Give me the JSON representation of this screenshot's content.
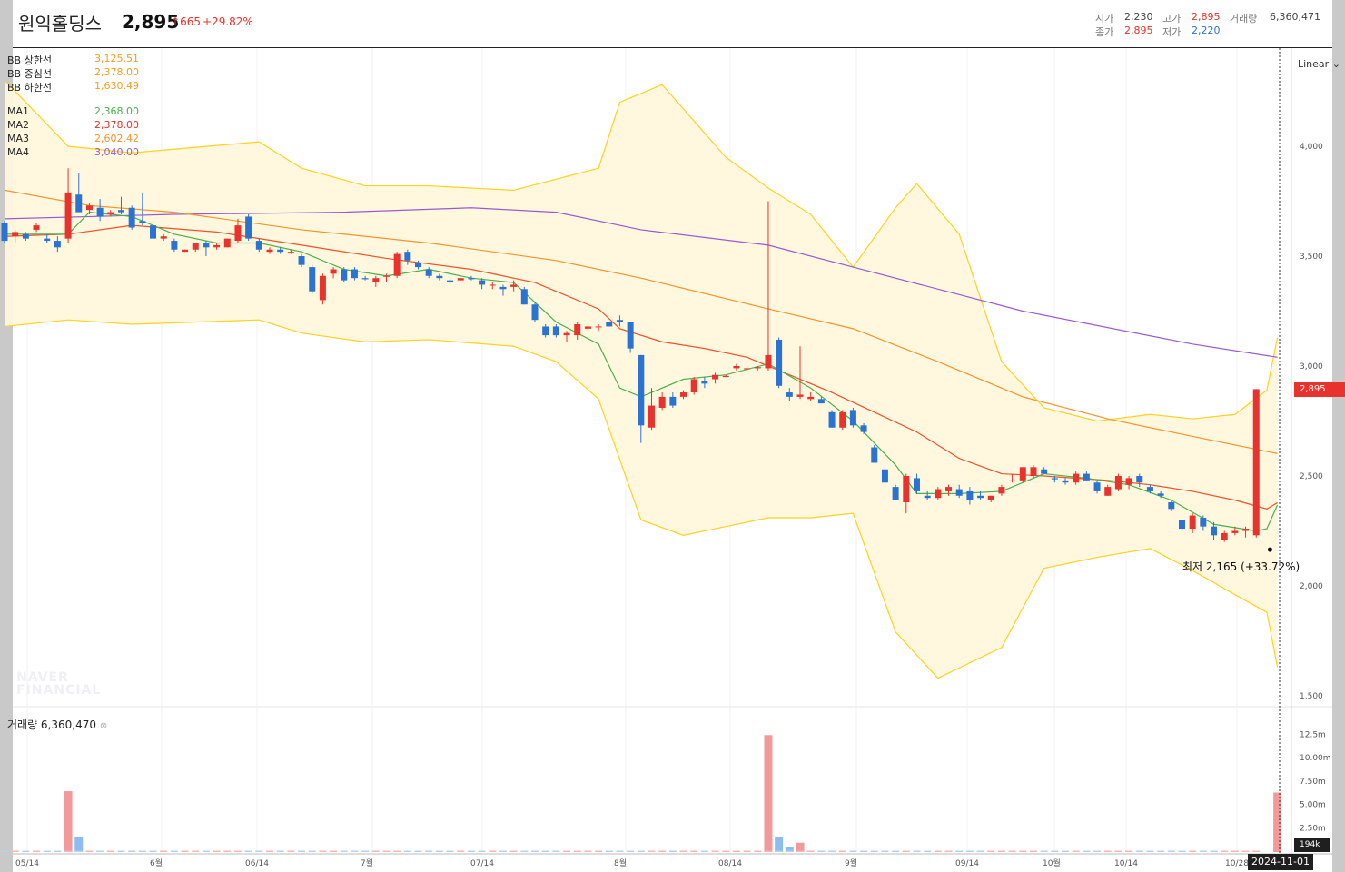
{
  "header": {
    "stock_name": "원익홀딩스",
    "price": "2,895",
    "change": "665",
    "change_pct": "+29.82%",
    "quote": {
      "open_label": "시가",
      "open": "2,230",
      "high_label": "고가",
      "high": "2,895",
      "volume_label": "거래량",
      "volume": "6,360,471",
      "close_label": "종가",
      "close": "2,895",
      "low_label": "저가",
      "low": "2,220"
    }
  },
  "legend": {
    "bb_upper_label": "BB 상한선",
    "bb_upper": "3,125.51",
    "bb_middle_label": "BB 중심선",
    "bb_middle": "2,378.00",
    "bb_lower_label": "BB 하한선",
    "bb_lower": "1,630.49",
    "ma1_label": "MA1",
    "ma1": "2,368.00",
    "ma2_label": "MA2",
    "ma2": "2,378.00",
    "ma3_label": "MA3",
    "ma3": "2,602.42",
    "ma4_label": "MA4",
    "ma4": "3,040.00"
  },
  "scale_mode": "Linear",
  "price_tag": "2,895",
  "volume_tag": "194k",
  "volume_legend": "거래량 6,360,470",
  "low_marker": "최저 2,165 (+33.72%)",
  "crosshair_date": "2024-11-01",
  "watermark": [
    "NAVER",
    "FINANCIAL"
  ],
  "colors": {
    "up": "#e8322d",
    "down": "#2b73d2",
    "bb_band": "#ffd21e",
    "bb_fill": "#fff8dc",
    "ma1": "#4caf50",
    "ma2": "#f0502a",
    "ma3": "#f7932a",
    "ma4": "#9b59d0"
  },
  "chart_data": {
    "type": "candlestick",
    "y_axis": {
      "min": 1500,
      "max": 4200,
      "ticks": [
        "4,000",
        "3,500",
        "3,000",
        "2,500",
        "2,000",
        "1,500"
      ]
    },
    "volume_axis": {
      "ticks": [
        "12.5m",
        "10.00m",
        "7.50m",
        "5.00m",
        "2.50m"
      ]
    },
    "x_ticks": [
      "05/14",
      "6월",
      "06/14",
      "7월",
      "07/14",
      "8월",
      "08/14",
      "9월",
      "09/14",
      "10월",
      "10/14",
      "10/28"
    ],
    "candles": [
      {
        "o": 3650,
        "h": 3660,
        "l": 3560,
        "c": 3570
      },
      {
        "o": 3590,
        "h": 3620,
        "l": 3560,
        "c": 3610
      },
      {
        "o": 3600,
        "h": 3610,
        "l": 3570,
        "c": 3580
      },
      {
        "o": 3620,
        "h": 3650,
        "l": 3610,
        "c": 3640
      },
      {
        "o": 3580,
        "h": 3600,
        "l": 3560,
        "c": 3570
      },
      {
        "o": 3570,
        "h": 3590,
        "l": 3520,
        "c": 3540
      },
      {
        "o": 3580,
        "h": 3900,
        "l": 3560,
        "c": 3790
      },
      {
        "o": 3780,
        "h": 3880,
        "l": 3710,
        "c": 3700
      },
      {
        "o": 3710,
        "h": 3740,
        "l": 3690,
        "c": 3730
      },
      {
        "o": 3720,
        "h": 3760,
        "l": 3660,
        "c": 3680
      },
      {
        "o": 3690,
        "h": 3710,
        "l": 3680,
        "c": 3700
      },
      {
        "o": 3710,
        "h": 3770,
        "l": 3690,
        "c": 3700
      },
      {
        "o": 3720,
        "h": 3730,
        "l": 3620,
        "c": 3630
      },
      {
        "o": 3660,
        "h": 3790,
        "l": 3640,
        "c": 3650
      },
      {
        "o": 3640,
        "h": 3660,
        "l": 3570,
        "c": 3580
      },
      {
        "o": 3580,
        "h": 3600,
        "l": 3570,
        "c": 3590
      },
      {
        "o": 3570,
        "h": 3580,
        "l": 3520,
        "c": 3530
      },
      {
        "o": 3520,
        "h": 3530,
        "l": 3520,
        "c": 3530
      },
      {
        "o": 3530,
        "h": 3560,
        "l": 3520,
        "c": 3560
      },
      {
        "o": 3560,
        "h": 3570,
        "l": 3500,
        "c": 3540
      },
      {
        "o": 3540,
        "h": 3560,
        "l": 3530,
        "c": 3550
      },
      {
        "o": 3540,
        "h": 3580,
        "l": 3540,
        "c": 3580
      },
      {
        "o": 3570,
        "h": 3670,
        "l": 3560,
        "c": 3640
      },
      {
        "o": 3680,
        "h": 3690,
        "l": 3570,
        "c": 3580
      },
      {
        "o": 3570,
        "h": 3580,
        "l": 3520,
        "c": 3530
      },
      {
        "o": 3520,
        "h": 3540,
        "l": 3510,
        "c": 3530
      },
      {
        "o": 3530,
        "h": 3540,
        "l": 3510,
        "c": 3520
      },
      {
        "o": 3520,
        "h": 3530,
        "l": 3510,
        "c": 3520
      },
      {
        "o": 3500,
        "h": 3510,
        "l": 3450,
        "c": 3460
      },
      {
        "o": 3450,
        "h": 3460,
        "l": 3330,
        "c": 3340
      },
      {
        "o": 3300,
        "h": 3420,
        "l": 3280,
        "c": 3410
      },
      {
        "o": 3420,
        "h": 3450,
        "l": 3400,
        "c": 3440
      },
      {
        "o": 3440,
        "h": 3450,
        "l": 3380,
        "c": 3390
      },
      {
        "o": 3440,
        "h": 3450,
        "l": 3390,
        "c": 3400
      },
      {
        "o": 3400,
        "h": 3410,
        "l": 3390,
        "c": 3395
      },
      {
        "o": 3380,
        "h": 3410,
        "l": 3360,
        "c": 3400
      },
      {
        "o": 3410,
        "h": 3420,
        "l": 3380,
        "c": 3410
      },
      {
        "o": 3410,
        "h": 3520,
        "l": 3400,
        "c": 3510
      },
      {
        "o": 3520,
        "h": 3530,
        "l": 3460,
        "c": 3480
      },
      {
        "o": 3470,
        "h": 3480,
        "l": 3440,
        "c": 3450
      },
      {
        "o": 3440,
        "h": 3450,
        "l": 3400,
        "c": 3410
      },
      {
        "o": 3410,
        "h": 3420,
        "l": 3390,
        "c": 3400
      },
      {
        "o": 3390,
        "h": 3400,
        "l": 3370,
        "c": 3380
      },
      {
        "o": 3390,
        "h": 3400,
        "l": 3390,
        "c": 3400
      },
      {
        "o": 3400,
        "h": 3410,
        "l": 3390,
        "c": 3395
      },
      {
        "o": 3390,
        "h": 3400,
        "l": 3350,
        "c": 3370
      },
      {
        "o": 3370,
        "h": 3380,
        "l": 3350,
        "c": 3370
      },
      {
        "o": 3360,
        "h": 3370,
        "l": 3320,
        "c": 3350
      },
      {
        "o": 3360,
        "h": 3390,
        "l": 3340,
        "c": 3370
      },
      {
        "o": 3350,
        "h": 3360,
        "l": 3280,
        "c": 3280
      },
      {
        "o": 3280,
        "h": 3290,
        "l": 3200,
        "c": 3210
      },
      {
        "o": 3180,
        "h": 3190,
        "l": 3130,
        "c": 3140
      },
      {
        "o": 3180,
        "h": 3190,
        "l": 3130,
        "c": 3140
      },
      {
        "o": 3140,
        "h": 3160,
        "l": 3110,
        "c": 3150
      },
      {
        "o": 3140,
        "h": 3200,
        "l": 3120,
        "c": 3190
      },
      {
        "o": 3170,
        "h": 3190,
        "l": 3160,
        "c": 3180
      },
      {
        "o": 3180,
        "h": 3190,
        "l": 3160,
        "c": 3180
      },
      {
        "o": 3200,
        "h": 3200,
        "l": 3180,
        "c": 3180
      },
      {
        "o": 3210,
        "h": 3230,
        "l": 3180,
        "c": 3200
      },
      {
        "o": 3200,
        "h": 3200,
        "l": 3060,
        "c": 3080
      },
      {
        "o": 3050,
        "h": 3050,
        "l": 2650,
        "c": 2730
      },
      {
        "o": 2720,
        "h": 2900,
        "l": 2710,
        "c": 2820
      },
      {
        "o": 2810,
        "h": 2880,
        "l": 2800,
        "c": 2860
      },
      {
        "o": 2860,
        "h": 2880,
        "l": 2810,
        "c": 2820
      },
      {
        "o": 2860,
        "h": 2890,
        "l": 2850,
        "c": 2880
      },
      {
        "o": 2880,
        "h": 2950,
        "l": 2870,
        "c": 2940
      },
      {
        "o": 2930,
        "h": 2950,
        "l": 2900,
        "c": 2920
      },
      {
        "o": 2940,
        "h": 2970,
        "l": 2920,
        "c": 2960
      },
      {
        "o": 2950,
        "h": 2960,
        "l": 2950,
        "c": 2955
      },
      {
        "o": 2990,
        "h": 3010,
        "l": 2980,
        "c": 3000
      },
      {
        "o": 2990,
        "h": 3000,
        "l": 2980,
        "c": 2990
      },
      {
        "o": 2990,
        "h": 3000,
        "l": 2980,
        "c": 2995
      },
      {
        "o": 2990,
        "h": 3750,
        "l": 2980,
        "c": 3050
      },
      {
        "o": 3120,
        "h": 3130,
        "l": 2900,
        "c": 2910
      },
      {
        "o": 2880,
        "h": 2900,
        "l": 2840,
        "c": 2860
      },
      {
        "o": 2860,
        "h": 3090,
        "l": 2850,
        "c": 2870
      },
      {
        "o": 2850,
        "h": 2880,
        "l": 2840,
        "c": 2860
      },
      {
        "o": 2850,
        "h": 2860,
        "l": 2830,
        "c": 2830
      },
      {
        "o": 2790,
        "h": 2800,
        "l": 2720,
        "c": 2720
      },
      {
        "o": 2720,
        "h": 2800,
        "l": 2710,
        "c": 2790
      },
      {
        "o": 2800,
        "h": 2810,
        "l": 2720,
        "c": 2730
      },
      {
        "o": 2730,
        "h": 2740,
        "l": 2690,
        "c": 2700
      },
      {
        "o": 2630,
        "h": 2640,
        "l": 2560,
        "c": 2560
      },
      {
        "o": 2530,
        "h": 2540,
        "l": 2470,
        "c": 2470
      },
      {
        "o": 2450,
        "h": 2460,
        "l": 2390,
        "c": 2390
      },
      {
        "o": 2380,
        "h": 2510,
        "l": 2330,
        "c": 2500
      },
      {
        "o": 2490,
        "h": 2510,
        "l": 2420,
        "c": 2430
      },
      {
        "o": 2410,
        "h": 2430,
        "l": 2390,
        "c": 2400
      },
      {
        "o": 2400,
        "h": 2450,
        "l": 2390,
        "c": 2440
      },
      {
        "o": 2430,
        "h": 2460,
        "l": 2410,
        "c": 2450
      },
      {
        "o": 2440,
        "h": 2460,
        "l": 2400,
        "c": 2410
      },
      {
        "o": 2430,
        "h": 2450,
        "l": 2370,
        "c": 2390
      },
      {
        "o": 2410,
        "h": 2430,
        "l": 2390,
        "c": 2400
      },
      {
        "o": 2390,
        "h": 2410,
        "l": 2380,
        "c": 2410
      },
      {
        "o": 2420,
        "h": 2460,
        "l": 2410,
        "c": 2450
      },
      {
        "o": 2480,
        "h": 2510,
        "l": 2470,
        "c": 2480
      },
      {
        "o": 2480,
        "h": 2540,
        "l": 2470,
        "c": 2540
      },
      {
        "o": 2500,
        "h": 2550,
        "l": 2490,
        "c": 2540
      },
      {
        "o": 2530,
        "h": 2540,
        "l": 2510,
        "c": 2510
      },
      {
        "o": 2490,
        "h": 2500,
        "l": 2470,
        "c": 2485
      },
      {
        "o": 2480,
        "h": 2490,
        "l": 2460,
        "c": 2470
      },
      {
        "o": 2470,
        "h": 2520,
        "l": 2460,
        "c": 2510
      },
      {
        "o": 2510,
        "h": 2520,
        "l": 2480,
        "c": 2480
      },
      {
        "o": 2470,
        "h": 2480,
        "l": 2420,
        "c": 2430
      },
      {
        "o": 2410,
        "h": 2460,
        "l": 2410,
        "c": 2450
      },
      {
        "o": 2440,
        "h": 2510,
        "l": 2430,
        "c": 2500
      },
      {
        "o": 2460,
        "h": 2500,
        "l": 2440,
        "c": 2490
      },
      {
        "o": 2500,
        "h": 2510,
        "l": 2450,
        "c": 2470
      },
      {
        "o": 2450,
        "h": 2460,
        "l": 2420,
        "c": 2430
      },
      {
        "o": 2420,
        "h": 2430,
        "l": 2400,
        "c": 2410
      },
      {
        "o": 2380,
        "h": 2390,
        "l": 2340,
        "c": 2350
      },
      {
        "o": 2300,
        "h": 2310,
        "l": 2250,
        "c": 2260
      },
      {
        "o": 2260,
        "h": 2330,
        "l": 2240,
        "c": 2320
      },
      {
        "o": 2310,
        "h": 2320,
        "l": 2250,
        "c": 2270
      },
      {
        "o": 2270,
        "h": 2290,
        "l": 2210,
        "c": 2230
      },
      {
        "o": 2210,
        "h": 2250,
        "l": 2200,
        "c": 2240
      },
      {
        "o": 2240,
        "h": 2270,
        "l": 2230,
        "c": 2250
      },
      {
        "o": 2250,
        "h": 2270,
        "l": 2220,
        "c": 2260
      },
      {
        "o": 2230,
        "h": 2895,
        "l": 2220,
        "c": 2895
      }
    ],
    "volume_spikes": [
      {
        "index": 6,
        "value": 6500000,
        "up": true
      },
      {
        "index": 7,
        "value": 1600000,
        "up": false
      },
      {
        "index": 72,
        "value": 12500000,
        "up": true
      },
      {
        "index": 73,
        "value": 1600000,
        "up": false
      },
      {
        "index": 74,
        "value": 500000,
        "up": false
      },
      {
        "index": 75,
        "value": 1000000,
        "up": true
      },
      {
        "index": 120,
        "value": 6360470,
        "up": true
      }
    ],
    "bb_upper": [
      [
        0,
        4300
      ],
      [
        6,
        4000
      ],
      [
        12,
        3970
      ],
      [
        24,
        4020
      ],
      [
        28,
        3900
      ],
      [
        34,
        3820
      ],
      [
        40,
        3820
      ],
      [
        48,
        3800
      ],
      [
        56,
        3900
      ],
      [
        58,
        4200
      ],
      [
        62,
        4280
      ],
      [
        68,
        3950
      ],
      [
        72,
        3810
      ],
      [
        76,
        3690
      ],
      [
        80,
        3450
      ],
      [
        84,
        3720
      ],
      [
        86,
        3830
      ],
      [
        90,
        3600
      ],
      [
        94,
        3020
      ],
      [
        98,
        2810
      ],
      [
        103,
        2750
      ],
      [
        108,
        2780
      ],
      [
        112,
        2760
      ],
      [
        116,
        2780
      ],
      [
        119,
        2890
      ],
      [
        120,
        3130
      ]
    ],
    "bb_lower": [
      [
        0,
        3180
      ],
      [
        6,
        3210
      ],
      [
        12,
        3190
      ],
      [
        24,
        3210
      ],
      [
        28,
        3150
      ],
      [
        34,
        3110
      ],
      [
        40,
        3120
      ],
      [
        48,
        3090
      ],
      [
        52,
        3020
      ],
      [
        56,
        2850
      ],
      [
        60,
        2300
      ],
      [
        64,
        2230
      ],
      [
        68,
        2270
      ],
      [
        72,
        2310
      ],
      [
        76,
        2310
      ],
      [
        80,
        2330
      ],
      [
        84,
        1790
      ],
      [
        88,
        1580
      ],
      [
        94,
        1720
      ],
      [
        98,
        2080
      ],
      [
        103,
        2130
      ],
      [
        108,
        2170
      ],
      [
        112,
        2070
      ],
      [
        116,
        1960
      ],
      [
        119,
        1880
      ],
      [
        120,
        1630
      ]
    ],
    "ma1": [
      [
        0,
        3600
      ],
      [
        6,
        3600
      ],
      [
        8,
        3700
      ],
      [
        12,
        3680
      ],
      [
        16,
        3600
      ],
      [
        20,
        3560
      ],
      [
        24,
        3560
      ],
      [
        28,
        3520
      ],
      [
        32,
        3440
      ],
      [
        36,
        3410
      ],
      [
        40,
        3440
      ],
      [
        44,
        3400
      ],
      [
        48,
        3380
      ],
      [
        52,
        3200
      ],
      [
        56,
        3100
      ],
      [
        58,
        2900
      ],
      [
        60,
        2860
      ],
      [
        64,
        2940
      ],
      [
        68,
        2960
      ],
      [
        72,
        3010
      ],
      [
        76,
        2900
      ],
      [
        80,
        2750
      ],
      [
        84,
        2550
      ],
      [
        86,
        2420
      ],
      [
        90,
        2420
      ],
      [
        94,
        2430
      ],
      [
        98,
        2510
      ],
      [
        102,
        2490
      ],
      [
        106,
        2460
      ],
      [
        110,
        2390
      ],
      [
        114,
        2280
      ],
      [
        118,
        2250
      ],
      [
        119,
        2260
      ],
      [
        120,
        2368
      ]
    ],
    "ma2": [
      [
        0,
        3590
      ],
      [
        6,
        3600
      ],
      [
        12,
        3640
      ],
      [
        20,
        3610
      ],
      [
        28,
        3550
      ],
      [
        36,
        3490
      ],
      [
        44,
        3440
      ],
      [
        50,
        3380
      ],
      [
        56,
        3260
      ],
      [
        58,
        3170
      ],
      [
        62,
        3110
      ],
      [
        66,
        3080
      ],
      [
        70,
        3040
      ],
      [
        74,
        2960
      ],
      [
        78,
        2880
      ],
      [
        82,
        2790
      ],
      [
        86,
        2700
      ],
      [
        90,
        2580
      ],
      [
        94,
        2510
      ],
      [
        98,
        2500
      ],
      [
        104,
        2480
      ],
      [
        108,
        2460
      ],
      [
        112,
        2430
      ],
      [
        116,
        2390
      ],
      [
        119,
        2350
      ],
      [
        120,
        2378
      ]
    ],
    "ma3": [
      [
        0,
        3800
      ],
      [
        8,
        3730
      ],
      [
        16,
        3700
      ],
      [
        28,
        3620
      ],
      [
        40,
        3560
      ],
      [
        52,
        3480
      ],
      [
        60,
        3400
      ],
      [
        72,
        3260
      ],
      [
        80,
        3170
      ],
      [
        88,
        3020
      ],
      [
        96,
        2860
      ],
      [
        104,
        2760
      ],
      [
        112,
        2680
      ],
      [
        120,
        2602
      ]
    ],
    "ma4": [
      [
        0,
        3670
      ],
      [
        16,
        3690
      ],
      [
        32,
        3700
      ],
      [
        44,
        3720
      ],
      [
        52,
        3700
      ],
      [
        60,
        3620
      ],
      [
        72,
        3550
      ],
      [
        80,
        3450
      ],
      [
        96,
        3250
      ],
      [
        112,
        3100
      ],
      [
        120,
        3040
      ]
    ]
  }
}
